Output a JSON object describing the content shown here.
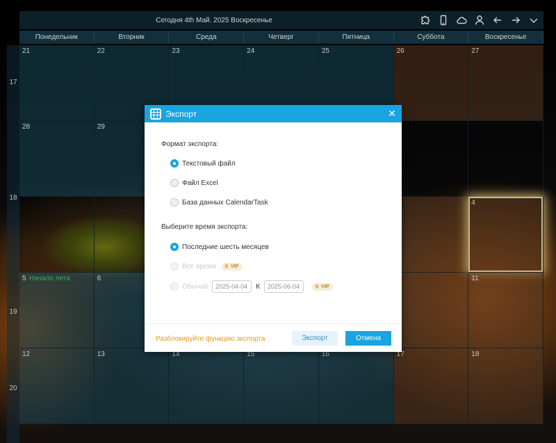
{
  "window": {
    "title": "Сегодня 4th Май. 2025 Воскресенье",
    "toolbar_icons": [
      "puzzle-icon",
      "phone-icon",
      "cloud-icon",
      "user-icon",
      "arrow-left-icon",
      "arrow-right-icon",
      "chevron-down-icon"
    ]
  },
  "calendar": {
    "weekdays": [
      "Понедельник",
      "Вторник",
      "Среда",
      "Четверг",
      "Пятница",
      "Суббота",
      "Воскресенье"
    ],
    "week_numbers": [
      "17",
      "18",
      "19",
      "20"
    ],
    "rows": [
      [
        "21",
        "22",
        "23",
        "24",
        "25",
        "26",
        "27"
      ],
      [
        "28",
        "29",
        "",
        "",
        "",
        "",
        ""
      ],
      [
        "",
        "",
        "",
        "",
        "",
        "",
        "4"
      ],
      [
        "5",
        "6",
        "",
        "",
        "",
        "",
        "11"
      ],
      [
        "12",
        "13",
        "14",
        "15",
        "16",
        "17",
        "18"
      ]
    ],
    "event_text": "Начало лета",
    "today": "4"
  },
  "dialog": {
    "title": "Экспорт",
    "format_label": "Формат экспорта:",
    "formats": [
      "Текстовый файл",
      "Файл Excel",
      "База данных CalendarTask"
    ],
    "selected_format": "Текстовый файл",
    "time_label": "Выберите время экспорта:",
    "time_options": [
      "Последние шесть месяцев",
      "Все время",
      "Обычай"
    ],
    "selected_time": "Последние шесть месяцев",
    "vip_label": "VIP",
    "date_from": "2025-04-04",
    "date_to": "2025-06-04",
    "date_sep": "К",
    "unlock_link": "Разблокируйте функцию экспорта",
    "export_button": "Экспорт",
    "cancel_button": "Отмена"
  },
  "colors": {
    "accent": "#1aa4e0",
    "unlock_link": "#e69a1a",
    "event_text": "#38d870",
    "header_bg": "#0f2833"
  }
}
